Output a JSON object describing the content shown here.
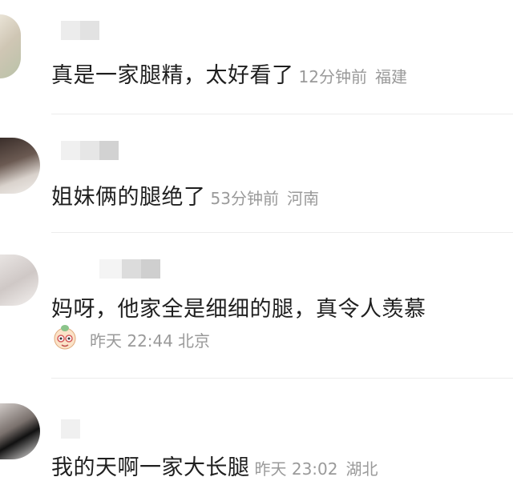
{
  "comments": [
    {
      "text": "真是一家腿精，太好看了",
      "time": "12分钟前",
      "location": "福建"
    },
    {
      "text": "姐妹俩的腿绝了",
      "time": "53分钟前",
      "location": "河南"
    },
    {
      "text": "妈呀，他家全是细细的腿，真令人羡慕",
      "time": "昨天 22:44",
      "location": "北京"
    },
    {
      "text": "我的天啊一家大长腿",
      "time": "昨天 23:02",
      "location": "湖北"
    }
  ]
}
